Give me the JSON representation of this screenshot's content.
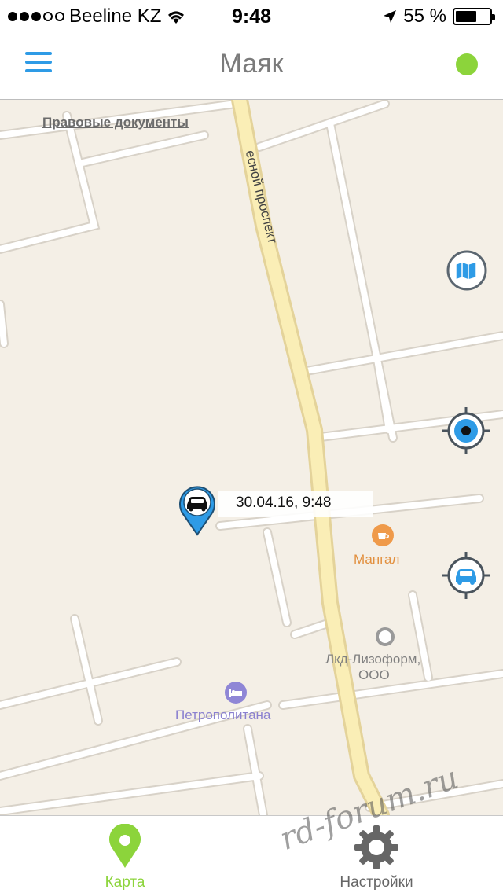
{
  "status_bar": {
    "carrier": "Beeline KZ",
    "time": "9:48",
    "battery_percent": "55 %",
    "battery_level": 0.55,
    "signal_dots_filled": 3,
    "signal_dots_total": 5
  },
  "nav": {
    "title": "Маяк",
    "status_color": "#8cd43b",
    "menu_icon": "hamburger-icon"
  },
  "map": {
    "legal_link": "Правовые документы",
    "street_name": "Лесной проспект",
    "street_name_visible": "есной проспект",
    "pois": [
      {
        "name": "Мангал",
        "icon": "cafe-icon",
        "color": "#ef9a4a"
      },
      {
        "name": "Лкд-Лизоформ,",
        "name2": "ООО",
        "icon": "place-icon",
        "color": "#9a9a9a"
      },
      {
        "name": "Петрополитана",
        "icon": "hotel-icon",
        "color": "#8f86d6"
      }
    ],
    "car_marker": {
      "timestamp": "30.04.16, 9:48",
      "color": "#2e9be6"
    },
    "buttons": {
      "map_type": "map-layers-icon",
      "my_location": "locate-me-icon",
      "locate_car": "locate-car-icon"
    }
  },
  "tabs": [
    {
      "label": "Карта",
      "icon": "map-pin-icon",
      "active": true,
      "color": "#8cd43b"
    },
    {
      "label": "Настройки",
      "icon": "gear-icon",
      "active": false,
      "color": "#666666"
    }
  ],
  "watermark": "rd-forum.ru"
}
